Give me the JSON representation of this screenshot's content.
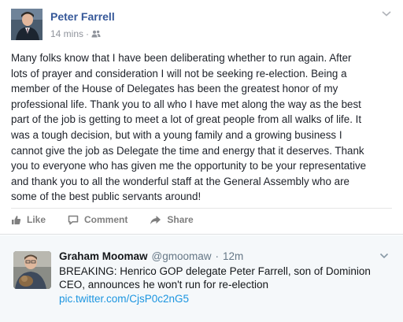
{
  "facebook_post": {
    "author": "Peter Farrell",
    "time": "14 mins",
    "separator": "·",
    "audience_icon": "friends-icon",
    "body": "Many folks know that I have been deliberating whether to run again. After\nlots of prayer and consideration I will not be seeking re-election. Being a\nmember of the House of Delegates has been the greatest honor of my\nprofessional life. Thank you to all who I have met along the way as the best\npart of the job is getting to meet a lot of great people from all walks of life. It\nwas a tough decision, but with a young family and a growing business I\ncannot give the job as Delegate the time and energy that it deserves. Thank\nyou to everyone who has given me the opportunity to be your representative\nand thank you to all the wonderful staff at the General Assembly who are\nsome of the best public servants around!",
    "actions": {
      "like": "Like",
      "comment": "Comment",
      "share": "Share"
    },
    "colors": {
      "name": "#365899",
      "meta": "#90949c",
      "actions": "#7f7f7f"
    }
  },
  "tweet": {
    "name": "Graham Moomaw",
    "handle": "@gmoomaw",
    "separator": "·",
    "time": "12m",
    "text": "BREAKING: Henrico GOP delegate Peter Farrell, son of Dominion CEO, announces he won't run for re-election",
    "link": "pic.twitter.com/CjsP0c2nG5",
    "colors": {
      "background": "#f5f8fa",
      "link": "#1b95e0",
      "muted": "#657786"
    }
  }
}
